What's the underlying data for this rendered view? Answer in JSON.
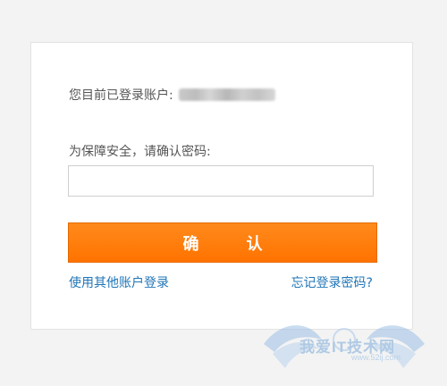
{
  "account": {
    "label": "您目前已登录账户:",
    "masked_value": ""
  },
  "verify": {
    "label": "为保障安全，请确认密码:",
    "password_value": "",
    "password_placeholder": ""
  },
  "actions": {
    "confirm_label": "确 认",
    "other_account_link": "使用其他账户登录",
    "forgot_password_link": "忘记登录密码?"
  },
  "watermark": {
    "text": "我爱IT技术网",
    "url": "www.52ij.com"
  },
  "colors": {
    "primary_button": "#ff7a00",
    "link": "#1f75b7",
    "card_border": "#e3e3e3"
  }
}
